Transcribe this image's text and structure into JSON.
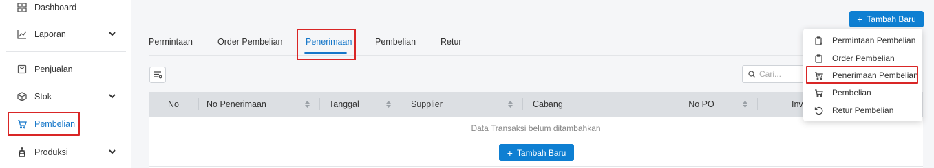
{
  "sidebar": {
    "items": [
      {
        "label": "Dashboard",
        "icon": "grid-icon"
      },
      {
        "label": "Laporan",
        "icon": "chart-line-icon"
      },
      {
        "label": "Penjualan",
        "icon": "bag-icon"
      },
      {
        "label": "Stok",
        "icon": "box-icon"
      },
      {
        "label": "Pembelian",
        "icon": "cart-icon"
      },
      {
        "label": "Produksi",
        "icon": "factory-icon"
      }
    ]
  },
  "header": {
    "add_button_label": "Tambah Baru"
  },
  "tabs": [
    {
      "label": "Permintaan"
    },
    {
      "label": "Order Pembelian"
    },
    {
      "label": "Penerimaan"
    },
    {
      "label": "Pembelian"
    },
    {
      "label": "Retur"
    }
  ],
  "search": {
    "placeholder": "Cari..."
  },
  "table": {
    "columns": [
      "No",
      "No Penerimaan",
      "Tanggal",
      "Supplier",
      "Cabang",
      "No PO",
      "Inv"
    ],
    "empty_message": "Data Transaksi belum ditambahkan",
    "add_button_label": "Tambah Baru"
  },
  "dropdown": {
    "items": [
      {
        "label": "Permintaan Pembelian",
        "icon": "clipboard-plus-icon"
      },
      {
        "label": "Order Pembelian",
        "icon": "clipboard-icon"
      },
      {
        "label": "Penerimaan Pembelian",
        "icon": "cart-receive-icon"
      },
      {
        "label": "Pembelian",
        "icon": "cart-icon"
      },
      {
        "label": "Retur Pembelian",
        "icon": "undo-icon"
      }
    ]
  },
  "colors": {
    "accent": "#1677c9",
    "primary_button": "#0e7fd2",
    "highlight": "#d92626",
    "table_header": "#dcdfe3"
  }
}
